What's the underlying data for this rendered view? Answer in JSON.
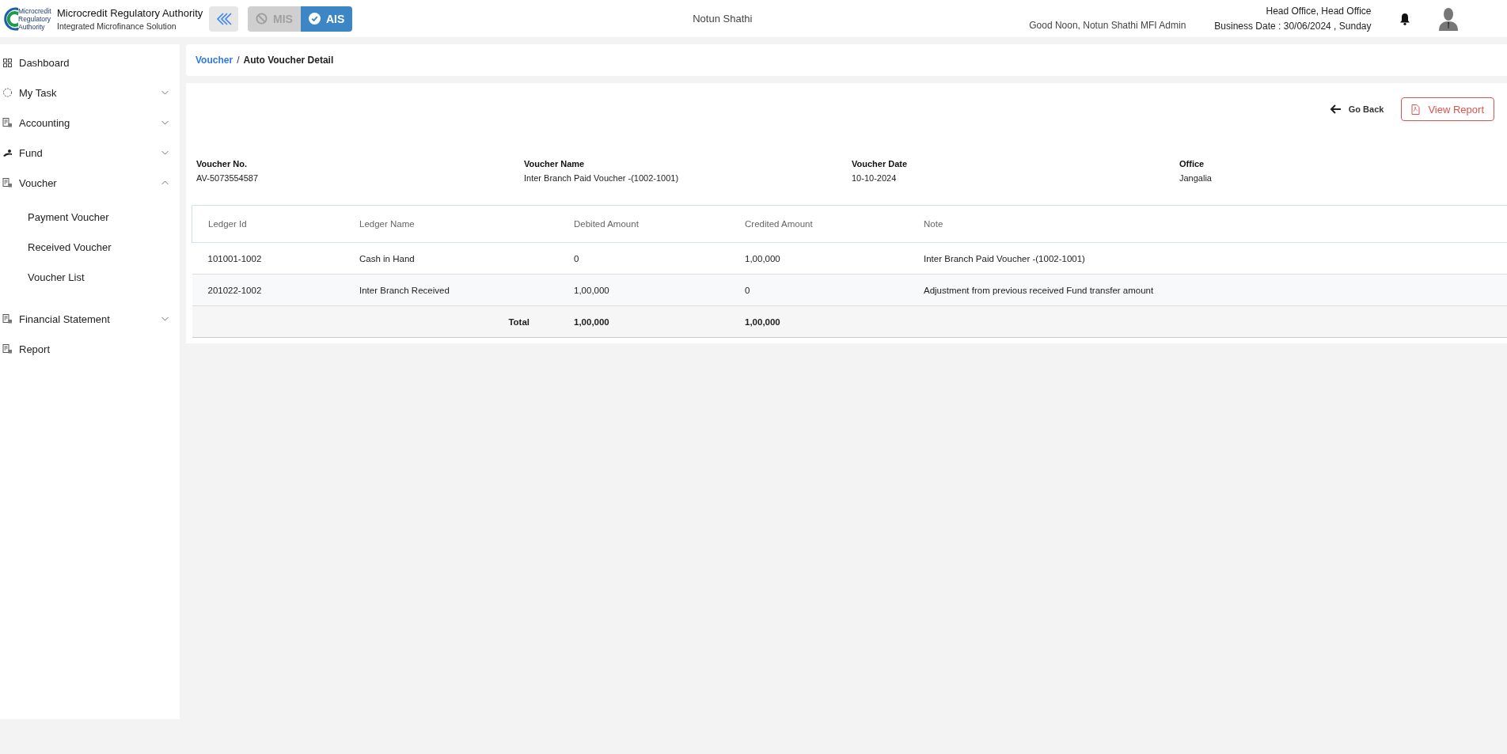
{
  "header": {
    "logo_text": [
      "Microcredit",
      "Regulatory",
      "Authority"
    ],
    "title": "Microcredit Regulatory Authority",
    "subtitle": "Integrated Microfinance Solution",
    "modes": [
      {
        "label": "MIS",
        "selected": false
      },
      {
        "label": "AIS",
        "selected": true
      }
    ],
    "org": "Notun Shathi",
    "greeting": "Good Noon, Notun Shathi MFI Admin",
    "office": "Head Office, Head Office",
    "business_date": "Business Date : 30/06/2024 , Sunday"
  },
  "sidebar": {
    "items": [
      {
        "label": "Dashboard",
        "kind": "link"
      },
      {
        "label": "My Task",
        "kind": "group",
        "expanded": false
      },
      {
        "label": "Accounting",
        "kind": "group",
        "expanded": false
      },
      {
        "label": "Fund",
        "kind": "group",
        "expanded": false
      },
      {
        "label": "Voucher",
        "kind": "group",
        "expanded": true,
        "children": [
          {
            "label": "Payment Voucher"
          },
          {
            "label": "Received Voucher"
          },
          {
            "label": "Voucher List"
          }
        ]
      },
      {
        "label": "Financial Statement",
        "kind": "group",
        "expanded": false
      },
      {
        "label": "Report",
        "kind": "link"
      }
    ]
  },
  "breadcrumb": [
    {
      "label": "Voucher",
      "kind": "link"
    },
    {
      "label": "/",
      "kind": "separator"
    },
    {
      "label": "Auto Voucher Detail",
      "kind": "current"
    }
  ],
  "actions": {
    "go_back": "Go Back",
    "view_report": "View Report"
  },
  "details": [
    {
      "label": "Voucher No.",
      "value": "AV-5073554587"
    },
    {
      "label": "Voucher Name",
      "value": "Inter Branch Paid Voucher -(1002-1001)"
    },
    {
      "label": "Voucher Date",
      "value": "10-10-2024"
    },
    {
      "label": "Office",
      "value": "Jangalia"
    }
  ],
  "table": {
    "columns": [
      "Ledger Id",
      "Ledger Name",
      "Debited Amount",
      "Credited Amount",
      "Note"
    ],
    "rows": [
      [
        "101001-1002",
        "Cash in Hand",
        "0",
        "1,00,000",
        "Inter Branch Paid Voucher -(1002-1001)"
      ],
      [
        "201022-1002",
        "Inter Branch Received",
        "1,00,000",
        "0",
        "Adjustment from previous received Fund transfer amount"
      ]
    ],
    "total": {
      "label": "Total",
      "debited": "1,00,000",
      "credited": "1,00,000"
    }
  }
}
